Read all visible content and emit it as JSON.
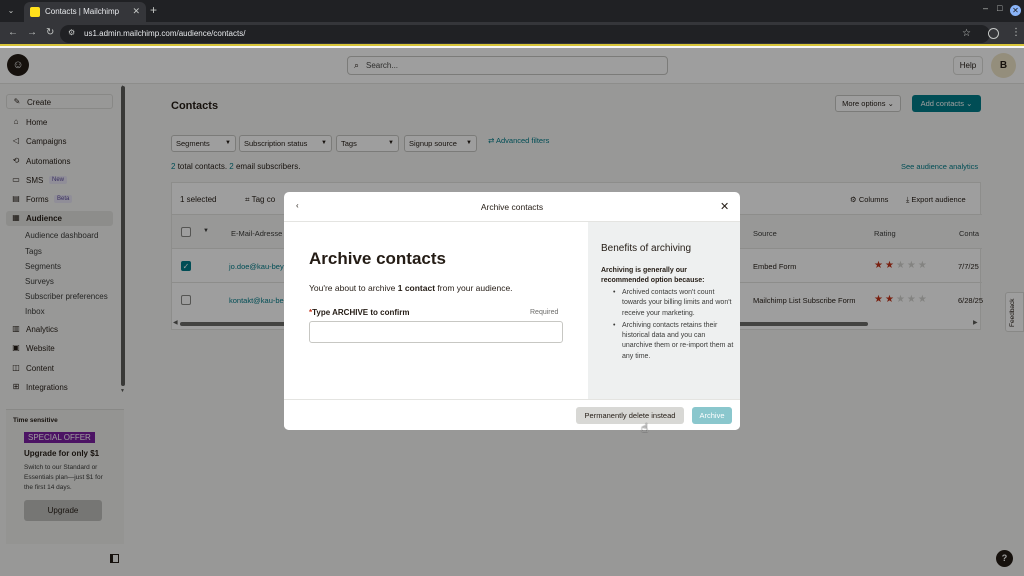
{
  "browser": {
    "tab_title": "Contacts | Mailchimp",
    "url": "us1.admin.mailchimp.com/audience/contacts/"
  },
  "header": {
    "search_placeholder": "Search...",
    "help": "Help",
    "avatar_initial": "B"
  },
  "sidebar": {
    "create": "Create",
    "items": [
      {
        "label": "Home",
        "icon": "home-icon"
      },
      {
        "label": "Campaigns",
        "icon": "megaphone-icon"
      },
      {
        "label": "Automations",
        "icon": "automations-icon"
      },
      {
        "label": "SMS",
        "icon": "sms-icon",
        "badge": "New"
      },
      {
        "label": "Forms",
        "icon": "forms-icon",
        "badge": "Beta"
      },
      {
        "label": "Audience",
        "icon": "audience-icon"
      }
    ],
    "audience_sub": [
      "Audience dashboard",
      "Tags",
      "Segments",
      "Surveys",
      "Subscriber preferences",
      "Inbox"
    ],
    "lower_items": [
      {
        "label": "Analytics",
        "icon": "analytics-icon"
      },
      {
        "label": "Website",
        "icon": "website-icon"
      },
      {
        "label": "Content",
        "icon": "content-icon"
      },
      {
        "label": "Integrations",
        "icon": "integrations-icon"
      }
    ],
    "promo": {
      "label": "Time sensitive",
      "offer": "SPECIAL OFFER",
      "title": "Upgrade for only $1",
      "desc": "Switch to our Standard or Essentials plan—just $1 for the first 14 days.",
      "button": "Upgrade"
    }
  },
  "main": {
    "title": "Contacts",
    "more_options": "More options",
    "add_contacts": "Add contacts",
    "filters": [
      "Segments",
      "Subscription status",
      "Tags",
      "Signup source"
    ],
    "advanced_filters": "Advanced filters",
    "totals": {
      "contacts_num": "2",
      "contacts_text": "total contacts.",
      "email_num": "2",
      "email_text": "email subscribers."
    },
    "analytics_link": "See audience analytics",
    "table": {
      "selected": "1 selected",
      "tag_contacts": "Tag co",
      "columns": "Columns",
      "export": "Export audience",
      "headers": {
        "email": "E-Mail-Adresse",
        "source": "Source",
        "rating": "Rating",
        "contact": "Conta"
      },
      "rows": [
        {
          "email": "jo.doe@kau-bey",
          "source": "Embed Form",
          "rating": 2,
          "date": "7/7/25",
          "checked": true
        },
        {
          "email": "kontakt@kau-be",
          "source": "Mailchimp List Subscribe Form",
          "rating": 2,
          "date": "6/28/25",
          "checked": false
        }
      ]
    }
  },
  "modal": {
    "header_title": "Archive contacts",
    "heading": "Archive contacts",
    "desc_pre": "You're about to archive ",
    "desc_bold": "1 contact",
    "desc_post": " from your audience.",
    "field_star": "*",
    "field_label": "Type ARCHIVE to confirm",
    "field_required": "Required",
    "field_value": "",
    "side_title": "Benefits of archiving",
    "side_intro": "Archiving is generally our recommended option because:",
    "side_points": [
      "Archived contacts won't count towards your billing limits and won't receive your marketing.",
      "Archiving contacts retains their historical data and you can unarchive them or re-import them at any time."
    ],
    "btn_delete": "Permanently delete instead",
    "btn_archive": "Archive"
  },
  "feedback": "Feedback",
  "help_bubble": "?"
}
